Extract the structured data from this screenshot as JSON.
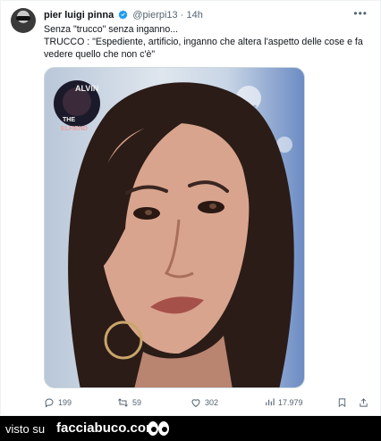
{
  "user": {
    "name": "pier luigi pinna",
    "handle": "@pierpi13",
    "separator": "·",
    "time": "14h"
  },
  "tweet": {
    "line1": "Senza \"trucco\" senza inganno...",
    "line2": "TRUCCO : \"Espediente, artificio, inganno che altera l'aspetto delle cose e fa vedere quello che non c'è\""
  },
  "media": {
    "poster_text": "ALVIN\nTHE\nELFIEND"
  },
  "actions": {
    "replies": "199",
    "reposts": "59",
    "likes": "302",
    "views": "17.979"
  },
  "footer": {
    "prefix": "visto su",
    "brand": "facciabuco.com"
  },
  "colors": {
    "accent": "#1d9bf0",
    "text_secondary": "#536471"
  }
}
